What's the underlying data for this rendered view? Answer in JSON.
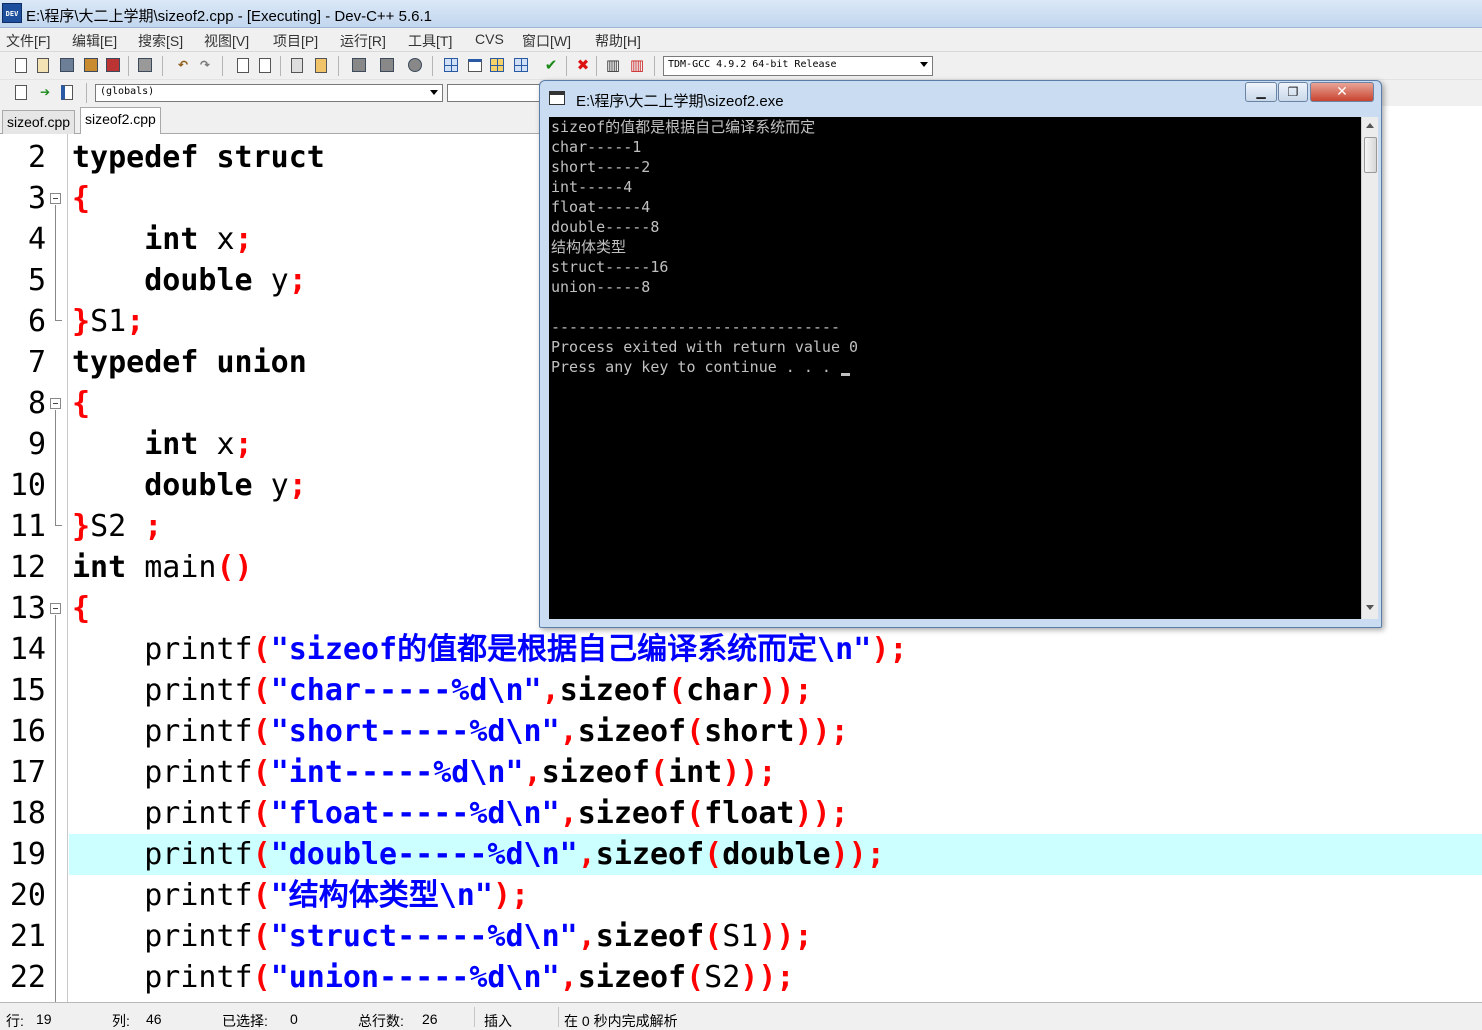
{
  "window": {
    "title": "E:\\程序\\大二上学期\\sizeof2.cpp - [Executing] - Dev-C++ 5.6.1",
    "icon": "DEV"
  },
  "menu": [
    "文件[F]",
    "编辑[E]",
    "搜索[S]",
    "视图[V]",
    "项目[P]",
    "运行[R]",
    "工具[T]",
    "CVS",
    "窗口[W]",
    "帮助[H]"
  ],
  "toolbar": {
    "compiler": "TDM-GCC 4.9.2 64-bit Release",
    "scope": "(globals)"
  },
  "tabs": [
    {
      "label": "sizeof.cpp",
      "active": false
    },
    {
      "label": "sizeof2.cpp",
      "active": true
    }
  ],
  "editor": {
    "highlight_line": 19,
    "lines": [
      {
        "n": "2",
        "tokens": [
          [
            "kw",
            "typedef struct"
          ]
        ]
      },
      {
        "n": "3",
        "tokens": [
          [
            "pn",
            "{"
          ]
        ]
      },
      {
        "n": "4",
        "tokens": [
          [
            "tx",
            "    "
          ],
          [
            "kw",
            "int"
          ],
          [
            "tx",
            " x"
          ],
          [
            "pn",
            ";"
          ]
        ]
      },
      {
        "n": "5",
        "tokens": [
          [
            "tx",
            "    "
          ],
          [
            "kw",
            "double"
          ],
          [
            "tx",
            " y"
          ],
          [
            "pn",
            ";"
          ]
        ]
      },
      {
        "n": "6",
        "tokens": [
          [
            "pn",
            "}"
          ],
          [
            "tx",
            "S1"
          ],
          [
            "pn",
            ";"
          ]
        ]
      },
      {
        "n": "7",
        "tokens": [
          [
            "kw",
            "typedef union"
          ]
        ]
      },
      {
        "n": "8",
        "tokens": [
          [
            "pn",
            "{"
          ]
        ]
      },
      {
        "n": "9",
        "tokens": [
          [
            "tx",
            "    "
          ],
          [
            "kw",
            "int"
          ],
          [
            "tx",
            " x"
          ],
          [
            "pn",
            ";"
          ]
        ]
      },
      {
        "n": "10",
        "tokens": [
          [
            "tx",
            "    "
          ],
          [
            "kw",
            "double"
          ],
          [
            "tx",
            " y"
          ],
          [
            "pn",
            ";"
          ]
        ]
      },
      {
        "n": "11",
        "tokens": [
          [
            "pn",
            "}"
          ],
          [
            "tx",
            "S2 "
          ],
          [
            "pn",
            ";"
          ]
        ]
      },
      {
        "n": "12",
        "tokens": [
          [
            "kw",
            "int"
          ],
          [
            "tx",
            " main"
          ],
          [
            "pn",
            "()"
          ]
        ]
      },
      {
        "n": "13",
        "tokens": [
          [
            "pn",
            "{"
          ]
        ]
      },
      {
        "n": "14",
        "tokens": [
          [
            "tx",
            "    printf"
          ],
          [
            "pn",
            "("
          ],
          [
            "st",
            "\"sizeof的值都是根据自己编译系统而定\\n\""
          ],
          [
            "pn",
            ");"
          ]
        ]
      },
      {
        "n": "15",
        "tokens": [
          [
            "tx",
            "    printf"
          ],
          [
            "pn",
            "("
          ],
          [
            "st",
            "\"char-----%d\\n\""
          ],
          [
            "pn",
            ","
          ],
          [
            "kw",
            "sizeof"
          ],
          [
            "pn",
            "("
          ],
          [
            "kw",
            "char"
          ],
          [
            "pn",
            "));"
          ]
        ]
      },
      {
        "n": "16",
        "tokens": [
          [
            "tx",
            "    printf"
          ],
          [
            "pn",
            "("
          ],
          [
            "st",
            "\"short-----%d\\n\""
          ],
          [
            "pn",
            ","
          ],
          [
            "kw",
            "sizeof"
          ],
          [
            "pn",
            "("
          ],
          [
            "kw",
            "short"
          ],
          [
            "pn",
            "));"
          ]
        ]
      },
      {
        "n": "17",
        "tokens": [
          [
            "tx",
            "    printf"
          ],
          [
            "pn",
            "("
          ],
          [
            "st",
            "\"int-----%d\\n\""
          ],
          [
            "pn",
            ","
          ],
          [
            "kw",
            "sizeof"
          ],
          [
            "pn",
            "("
          ],
          [
            "kw",
            "int"
          ],
          [
            "pn",
            "));"
          ]
        ]
      },
      {
        "n": "18",
        "tokens": [
          [
            "tx",
            "    printf"
          ],
          [
            "pn",
            "("
          ],
          [
            "st",
            "\"float-----%d\\n\""
          ],
          [
            "pn",
            ","
          ],
          [
            "kw",
            "sizeof"
          ],
          [
            "pn",
            "("
          ],
          [
            "kw",
            "float"
          ],
          [
            "pn",
            "));"
          ]
        ]
      },
      {
        "n": "19",
        "tokens": [
          [
            "tx",
            "    printf"
          ],
          [
            "pn",
            "("
          ],
          [
            "st",
            "\"double-----%d\\n\""
          ],
          [
            "pn",
            ","
          ],
          [
            "kw",
            "sizeof"
          ],
          [
            "pn",
            "("
          ],
          [
            "kw",
            "double"
          ],
          [
            "pn",
            "));"
          ]
        ]
      },
      {
        "n": "20",
        "tokens": [
          [
            "tx",
            "    printf"
          ],
          [
            "pn",
            "("
          ],
          [
            "st",
            "\"结构体类型\\n\""
          ],
          [
            "pn",
            ");"
          ]
        ]
      },
      {
        "n": "21",
        "tokens": [
          [
            "tx",
            "    printf"
          ],
          [
            "pn",
            "("
          ],
          [
            "st",
            "\"struct-----%d\\n\""
          ],
          [
            "pn",
            ","
          ],
          [
            "kw",
            "sizeof"
          ],
          [
            "pn",
            "("
          ],
          [
            "tx",
            "S1"
          ],
          [
            "pn",
            "));"
          ]
        ]
      },
      {
        "n": "22",
        "tokens": [
          [
            "tx",
            "    printf"
          ],
          [
            "pn",
            "("
          ],
          [
            "st",
            "\"union-----%d\\n\""
          ],
          [
            "pn",
            ","
          ],
          [
            "kw",
            "sizeof"
          ],
          [
            "pn",
            "("
          ],
          [
            "tx",
            "S2"
          ],
          [
            "pn",
            "));"
          ]
        ]
      }
    ]
  },
  "status": {
    "row_label": "行:",
    "row": "19",
    "col_label": "列:",
    "col": "46",
    "sel_label": "已选择:",
    "sel": "0",
    "total_label": "总行数:",
    "total": "26",
    "mode": "插入",
    "parse": "在 0 秒内完成解析"
  },
  "console": {
    "title": "E:\\程序\\大二上学期\\sizeof2.exe",
    "lines": [
      "sizeof的值都是根据自己编译系统而定",
      "char-----1",
      "short-----2",
      "int-----4",
      "float-----4",
      "double-----8",
      "结构体类型",
      "struct-----16",
      "union-----8",
      "",
      "--------------------------------",
      "Process exited with return value 0",
      "Press any key to continue . . . "
    ]
  },
  "colors": {
    "keyword": "#000000",
    "punct": "#ff0000",
    "string": "#0000ff",
    "highlight": "#ccffff",
    "console_bg": "#000000",
    "console_fg": "#c0c0c0"
  }
}
